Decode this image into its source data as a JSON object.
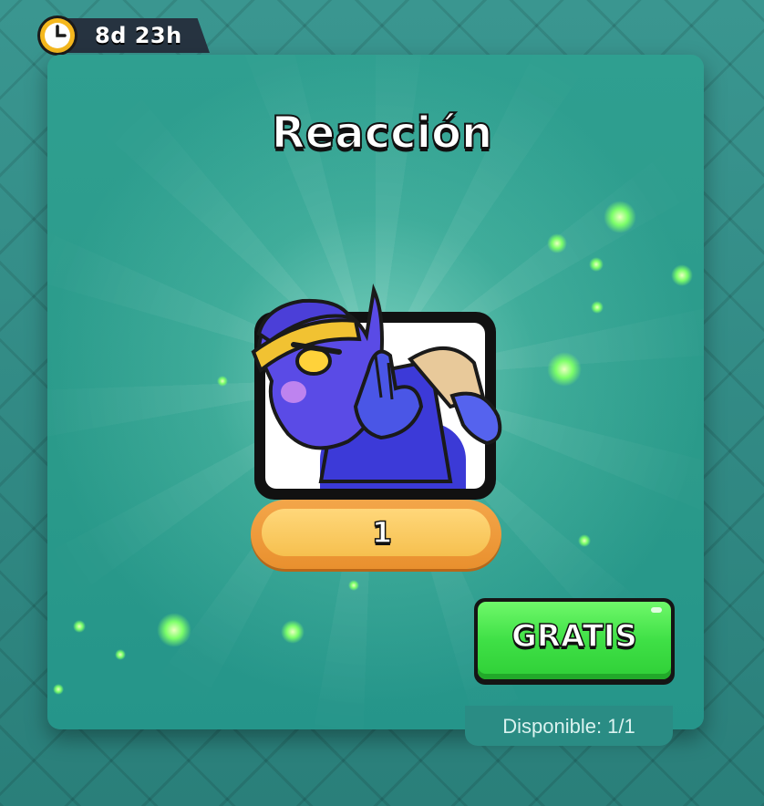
{
  "timer": {
    "label": "8d 23h",
    "icon": "clock-icon"
  },
  "offer": {
    "title": "Reacción",
    "quantity": "1",
    "item_icon": "goblin-emote",
    "price_button": "GRATIS",
    "availability": "Disponible: 1/1"
  },
  "colors": {
    "panel": "#2a9a8a",
    "button_green": "#3fe046",
    "pill_orange": "#f6c04f",
    "timer_bar": "#263340"
  }
}
